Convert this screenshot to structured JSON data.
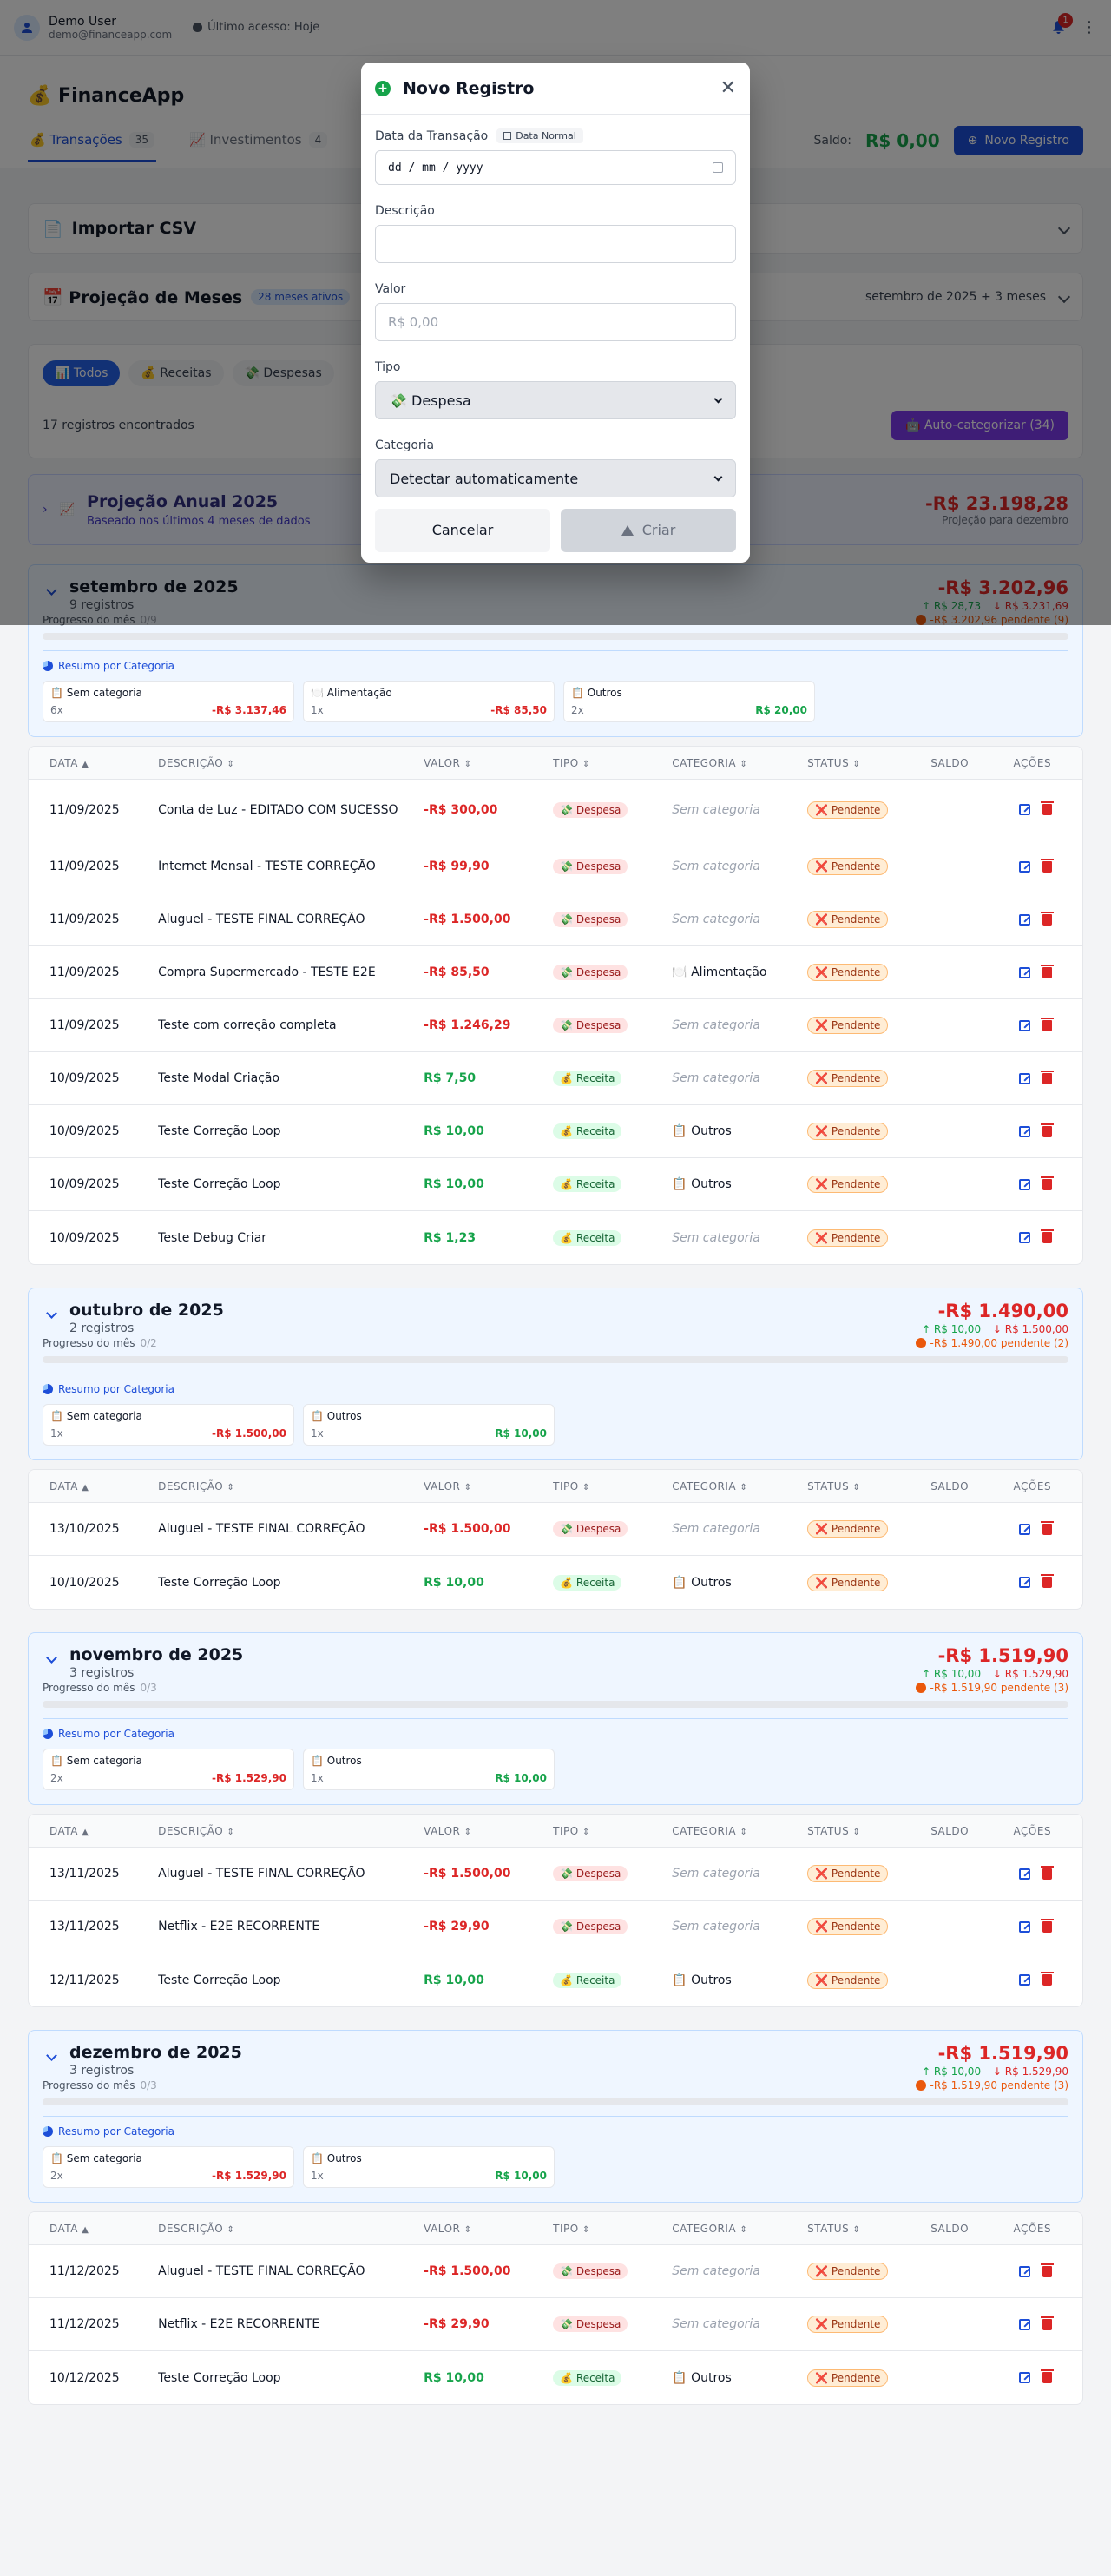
{
  "topbar": {
    "user_name": "Demo User",
    "user_email": "demo@financeapp.com",
    "last_access": "Último acesso: Hoje",
    "notification_count": "1"
  },
  "header": {
    "app_title": "💰 FinanceApp",
    "tabs": [
      {
        "label": "💰 Transações",
        "count": "35"
      },
      {
        "label": "📈 Investimentos",
        "count": "4"
      }
    ],
    "saldo_label": "Saldo:",
    "saldo_value": "R$ 0,00",
    "new_record": "Novo Registro"
  },
  "import_csv": {
    "title": "Importar CSV"
  },
  "projection": {
    "title": "📅 Projeção de Meses",
    "badge": "28 meses ativos",
    "range": "setembro de 2025 + 3 meses"
  },
  "filters": {
    "all": "📊 Todos",
    "income": "💰 Receitas",
    "expense": "💸 Despesas",
    "records_found": "17 registros encontrados",
    "auto_categorize": "🤖 Auto-categorizar (34)"
  },
  "annual": {
    "title": "Projeção Anual 2025",
    "subtitle": "Baseado nos últimos 4 meses de dados",
    "value": "-R$ 23.198,28",
    "note": "Projeção para dezembro"
  },
  "table_headers": {
    "date": "DATA",
    "desc": "DESCRIÇÃO",
    "value": "VALOR",
    "type": "TIPO",
    "category": "CATEGORIA",
    "status": "STATUS",
    "saldo": "SALDO",
    "actions": "AÇÕES"
  },
  "labels": {
    "progress": "Progresso do mês",
    "cat_summary": "Resumo por Categoria"
  },
  "months": [
    {
      "name": "setembro de 2025",
      "count": "9 registros",
      "balance": "-R$ 3.202,96",
      "income": "↑ R$ 28,73",
      "expense": "↓ R$ 3.231,69",
      "progress": "0/9",
      "progress_fraction": 0,
      "pending": "-R$ 3.202,96 pendente (9)",
      "categories": [
        {
          "name": "📋 Sem categoria",
          "count": "6x",
          "amount": "-R$ 3.137,46",
          "sign": "neg"
        },
        {
          "name": "🍽️ Alimentação",
          "count": "1x",
          "amount": "-R$ 85,50",
          "sign": "neg"
        },
        {
          "name": "📋 Outros",
          "count": "2x",
          "amount": "R$ 20,00",
          "sign": "pos"
        }
      ],
      "rows": [
        {
          "date": "11/09/2025",
          "desc": "Conta de Luz - EDITADO COM SUCESSO",
          "value": "-R$ 300,00",
          "type": "💸 Despesa",
          "category": "Sem categoria",
          "status": "❌ Pendente"
        },
        {
          "date": "11/09/2025",
          "desc": "Internet Mensal - TESTE CORREÇÃO",
          "value": "-R$ 99,90",
          "type": "💸 Despesa",
          "category": "Sem categoria",
          "status": "❌ Pendente"
        },
        {
          "date": "11/09/2025",
          "desc": "Aluguel - TESTE FINAL CORREÇÃO",
          "value": "-R$ 1.500,00",
          "type": "💸 Despesa",
          "category": "Sem categoria",
          "status": "❌ Pendente"
        },
        {
          "date": "11/09/2025",
          "desc": "Compra Supermercado - TESTE E2E",
          "value": "-R$ 85,50",
          "type": "💸 Despesa",
          "category": "🍽️ Alimentação",
          "status": "❌ Pendente"
        },
        {
          "date": "11/09/2025",
          "desc": "Teste com correção completa",
          "value": "-R$ 1.246,29",
          "type": "💸 Despesa",
          "category": "Sem categoria",
          "status": "❌ Pendente"
        },
        {
          "date": "10/09/2025",
          "desc": "Teste Modal Criação",
          "value": "R$ 7,50",
          "type": "💰 Receita",
          "category": "Sem categoria",
          "status": "❌ Pendente"
        },
        {
          "date": "10/09/2025",
          "desc": "Teste Correção Loop",
          "value": "R$ 10,00",
          "type": "💰 Receita",
          "category": "📋 Outros",
          "status": "❌ Pendente"
        },
        {
          "date": "10/09/2025",
          "desc": "Teste Correção Loop",
          "value": "R$ 10,00",
          "type": "💰 Receita",
          "category": "📋 Outros",
          "status": "❌ Pendente"
        },
        {
          "date": "10/09/2025",
          "desc": "Teste Debug Criar",
          "value": "R$ 1,23",
          "type": "💰 Receita",
          "category": "Sem categoria",
          "status": "❌ Pendente"
        }
      ]
    },
    {
      "name": "outubro de 2025",
      "count": "2 registros",
      "balance": "-R$ 1.490,00",
      "income": "↑ R$ 10,00",
      "expense": "↓ R$ 1.500,00",
      "progress": "0/2",
      "progress_fraction": 0,
      "pending": "-R$ 1.490,00 pendente (2)",
      "categories": [
        {
          "name": "📋 Sem categoria",
          "count": "1x",
          "amount": "-R$ 1.500,00",
          "sign": "neg"
        },
        {
          "name": "📋 Outros",
          "count": "1x",
          "amount": "R$ 10,00",
          "sign": "pos"
        }
      ],
      "rows": [
        {
          "date": "13/10/2025",
          "desc": "Aluguel - TESTE FINAL CORREÇÃO",
          "value": "-R$ 1.500,00",
          "type": "💸 Despesa",
          "category": "Sem categoria",
          "status": "❌ Pendente"
        },
        {
          "date": "10/10/2025",
          "desc": "Teste Correção Loop",
          "value": "R$ 10,00",
          "type": "💰 Receita",
          "category": "📋 Outros",
          "status": "❌ Pendente"
        }
      ]
    },
    {
      "name": "novembro de 2025",
      "count": "3 registros",
      "balance": "-R$ 1.519,90",
      "income": "↑ R$ 10,00",
      "expense": "↓ R$ 1.529,90",
      "progress": "0/3",
      "progress_fraction": 0,
      "pending": "-R$ 1.519,90 pendente (3)",
      "categories": [
        {
          "name": "📋 Sem categoria",
          "count": "2x",
          "amount": "-R$ 1.529,90",
          "sign": "neg"
        },
        {
          "name": "📋 Outros",
          "count": "1x",
          "amount": "R$ 10,00",
          "sign": "pos"
        }
      ],
      "rows": [
        {
          "date": "13/11/2025",
          "desc": "Aluguel - TESTE FINAL CORREÇÃO",
          "value": "-R$ 1.500,00",
          "type": "💸 Despesa",
          "category": "Sem categoria",
          "status": "❌ Pendente"
        },
        {
          "date": "13/11/2025",
          "desc": "Netflix - E2E RECORRENTE",
          "value": "-R$ 29,90",
          "type": "💸 Despesa",
          "category": "Sem categoria",
          "status": "❌ Pendente"
        },
        {
          "date": "12/11/2025",
          "desc": "Teste Correção Loop",
          "value": "R$ 10,00",
          "type": "💰 Receita",
          "category": "📋 Outros",
          "status": "❌ Pendente"
        }
      ]
    },
    {
      "name": "dezembro de 2025",
      "count": "3 registros",
      "balance": "-R$ 1.519,90",
      "income": "↑ R$ 10,00",
      "expense": "↓ R$ 1.529,90",
      "progress": "0/3",
      "progress_fraction": 0,
      "pending": "-R$ 1.519,90 pendente (3)",
      "categories": [
        {
          "name": "📋 Sem categoria",
          "count": "2x",
          "amount": "-R$ 1.529,90",
          "sign": "neg"
        },
        {
          "name": "📋 Outros",
          "count": "1x",
          "amount": "R$ 10,00",
          "sign": "pos"
        }
      ],
      "rows": [
        {
          "date": "11/12/2025",
          "desc": "Aluguel - TESTE FINAL CORREÇÃO",
          "value": "-R$ 1.500,00",
          "type": "💸 Despesa",
          "category": "Sem categoria",
          "status": "❌ Pendente"
        },
        {
          "date": "11/12/2025",
          "desc": "Netflix - E2E RECORRENTE",
          "value": "-R$ 29,90",
          "type": "💸 Despesa",
          "category": "Sem categoria",
          "status": "❌ Pendente"
        },
        {
          "date": "10/12/2025",
          "desc": "Teste Correção Loop",
          "value": "R$ 10,00",
          "type": "💰 Receita",
          "category": "📋 Outros",
          "status": "❌ Pendente"
        }
      ]
    }
  ],
  "modal": {
    "title": "Novo Registro",
    "date_label": "Data da Transação",
    "date_badge": "Data Normal",
    "date_value": "dd / mm / yyyy",
    "desc_label": "Descrição",
    "desc_value": "",
    "value_label": "Valor",
    "value_placeholder": "R$ 0,00",
    "type_label": "Tipo",
    "type_value": "💸 Despesa",
    "category_label": "Categoria",
    "category_value": "Detectar automaticamente",
    "cancel": "Cancelar",
    "create": "Criar"
  },
  "colors": {
    "primary": "#1d4ed8",
    "income": "#16a34a",
    "expense": "#dc2626",
    "pending": "#ea580c",
    "purple": "#7c3aed"
  }
}
